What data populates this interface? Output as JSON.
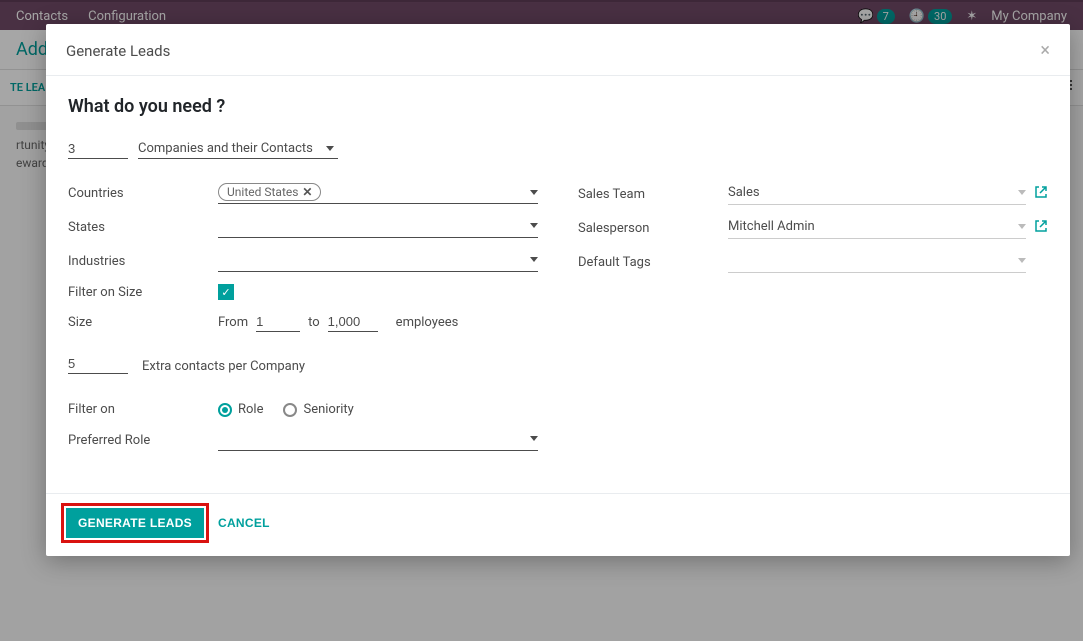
{
  "topbar": {
    "menu": [
      "Contacts",
      "Configuration"
    ],
    "chat_badge": "7",
    "activity_badge": "30",
    "company": "My Company"
  },
  "secondbar": {
    "breadcrumb": "Addic"
  },
  "thirdbar": {
    "left_button": "TE LEAD"
  },
  "kanban": {
    "col1": "rtunity",
    "col2": "eward"
  },
  "modal": {
    "title": "Generate Leads",
    "heading": "What do you need ?",
    "qty_value": "3",
    "type_value": "Companies and their Contacts",
    "labels": {
      "countries": "Countries",
      "states": "States",
      "industries": "Industries",
      "filter_size": "Filter on Size",
      "size": "Size",
      "from": "From",
      "to": "to",
      "employees": "employees",
      "sales_team": "Sales Team",
      "salesperson": "Salesperson",
      "default_tags": "Default Tags",
      "extra_contacts": "Extra contacts per Company",
      "filter_on": "Filter on",
      "role_label": "Role",
      "seniority_label": "Seniority",
      "preferred_role": "Preferred Role"
    },
    "countries_tag": "United States",
    "size_from": "1",
    "size_to": "1,000",
    "extra_contacts_value": "5",
    "sales_team_value": "Sales",
    "salesperson_value": "Mitchell Admin",
    "footer": {
      "generate": "GENERATE LEADS",
      "cancel": "CANCEL"
    }
  }
}
